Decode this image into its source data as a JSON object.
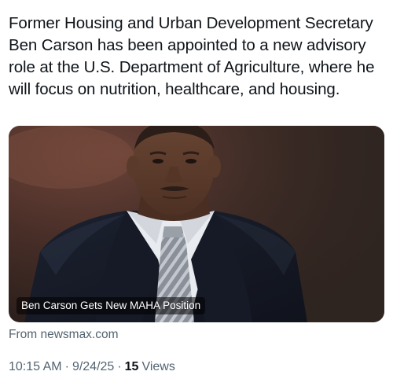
{
  "post": {
    "text": "Former Housing and Urban Development Secretary Ben Carson has been appointed to a new advisory role at the U.S. Department of Agriculture, where he will focus on nutrition, healthcare, and housing."
  },
  "link_card": {
    "image_subject": "portrait photo of a man in a dark suit, white shirt and striped grey tie",
    "caption": "Ben Carson Gets New MAHA Position",
    "source": "From newsmax.com"
  },
  "meta": {
    "time": "10:15 AM",
    "separator": "·",
    "date": "9/24/25",
    "views_count": "15",
    "views_label": "Views"
  },
  "colors": {
    "text_primary": "#0f1419",
    "text_secondary": "#536471",
    "card_background": "#3b2a24"
  }
}
